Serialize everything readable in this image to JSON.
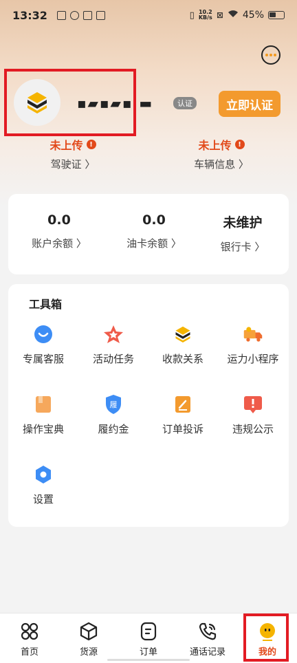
{
  "status_bar": {
    "time": "13:32",
    "network_speed_top": "10.2",
    "network_speed_unit": "KB/s",
    "battery": "45%"
  },
  "profile": {
    "name": "▪▰▪▰▪ ▬",
    "verify_tag": "认证",
    "verify_button": "立即认证",
    "license_state": "未上传",
    "license_label": "驾驶证 〉",
    "vehicle_state": "未上传",
    "vehicle_label": "车辆信息 〉"
  },
  "balances": [
    {
      "value": "0.0",
      "label": "账户余额 〉"
    },
    {
      "value": "0.0",
      "label": "油卡余额 〉"
    },
    {
      "value": "未维护",
      "label": "银行卡 〉"
    }
  ],
  "toolbox": {
    "title": "工具箱",
    "items": [
      {
        "label": "专属客服",
        "icon": "customer-service-icon"
      },
      {
        "label": "活动任务",
        "icon": "star-task-icon"
      },
      {
        "label": "收款关系",
        "icon": "payee-relation-icon"
      },
      {
        "label": "运力小程序",
        "icon": "truck-icon"
      },
      {
        "label": "操作宝典",
        "icon": "guide-book-icon"
      },
      {
        "label": "履约金",
        "icon": "deposit-shield-icon"
      },
      {
        "label": "订单投诉",
        "icon": "complaint-icon"
      },
      {
        "label": "违规公示",
        "icon": "violation-notice-icon"
      },
      {
        "label": "设置",
        "icon": "gear-icon"
      }
    ]
  },
  "bottom_nav": [
    {
      "label": "首页",
      "icon": "home-grid-icon"
    },
    {
      "label": "货源",
      "icon": "cargo-box-icon"
    },
    {
      "label": "订单",
      "icon": "order-icon"
    },
    {
      "label": "通话记录",
      "icon": "phone-icon"
    },
    {
      "label": "我的",
      "icon": "me-icon"
    }
  ],
  "colors": {
    "accent": "#f39a2e",
    "warning": "#e2491a",
    "highlight_box": "#e21b23"
  }
}
